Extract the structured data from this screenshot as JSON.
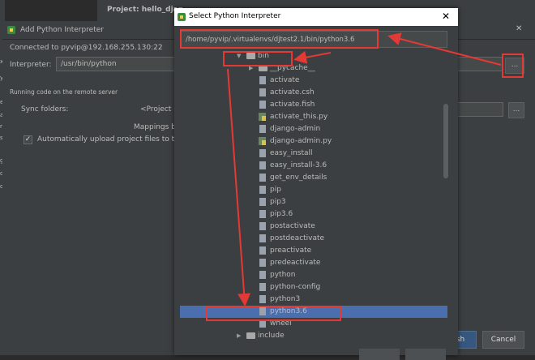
{
  "ide": {
    "project_title": "Project: hello_djan",
    "strip_letters": [
      "x",
      "y",
      "e",
      "a",
      "r",
      "s",
      "g",
      "c",
      "o"
    ]
  },
  "add_dialog": {
    "title": "Add Python Interpreter",
    "connected": "Connected to pyvip@192.168.255.130:22",
    "interpreter_label": "Interpreter:",
    "interpreter_value": "/usr/bin/python",
    "browse_label": "...",
    "running_label": "Running code on the remote server",
    "sync_label": "Sync folders:",
    "sync_value": "<Project ro",
    "sync_browse_label": "...",
    "mappings_label": "Mappings b",
    "auto_upload_label": "Automatically upload project files to the",
    "auto_upload_checked": "✓",
    "finish_label": "sh",
    "cancel_label": "Cancel"
  },
  "select_dialog": {
    "title": "Select Python Interpreter",
    "close_icon": "✕",
    "path": "/home/pyvip/.virtualenvs/djtest2.1/bin/python3.6",
    "tree": [
      {
        "label": "bin",
        "kind": "folder",
        "expanded": true
      },
      {
        "label": "__pycache__",
        "kind": "folder",
        "expanded": false
      },
      {
        "label": "activate",
        "kind": "file"
      },
      {
        "label": "activate.csh",
        "kind": "file"
      },
      {
        "label": "activate.fish",
        "kind": "file"
      },
      {
        "label": "activate_this.py",
        "kind": "py"
      },
      {
        "label": "django-admin",
        "kind": "file"
      },
      {
        "label": "django-admin.py",
        "kind": "py"
      },
      {
        "label": "easy_install",
        "kind": "file"
      },
      {
        "label": "easy_install-3.6",
        "kind": "file"
      },
      {
        "label": "get_env_details",
        "kind": "file"
      },
      {
        "label": "pip",
        "kind": "file"
      },
      {
        "label": "pip3",
        "kind": "file"
      },
      {
        "label": "pip3.6",
        "kind": "file"
      },
      {
        "label": "postactivate",
        "kind": "file"
      },
      {
        "label": "postdeactivate",
        "kind": "file"
      },
      {
        "label": "preactivate",
        "kind": "file"
      },
      {
        "label": "predeactivate",
        "kind": "file"
      },
      {
        "label": "python",
        "kind": "file"
      },
      {
        "label": "python-config",
        "kind": "file"
      },
      {
        "label": "python3",
        "kind": "file"
      },
      {
        "label": "python3.6",
        "kind": "file",
        "selected": true
      },
      {
        "label": "wheel",
        "kind": "file"
      },
      {
        "label": "include",
        "kind": "folder",
        "expanded": false
      }
    ]
  },
  "colors": {
    "annotation_red": "#e53935",
    "selection": "#4b6eaf",
    "dialog_bg": "#3c3f41"
  }
}
